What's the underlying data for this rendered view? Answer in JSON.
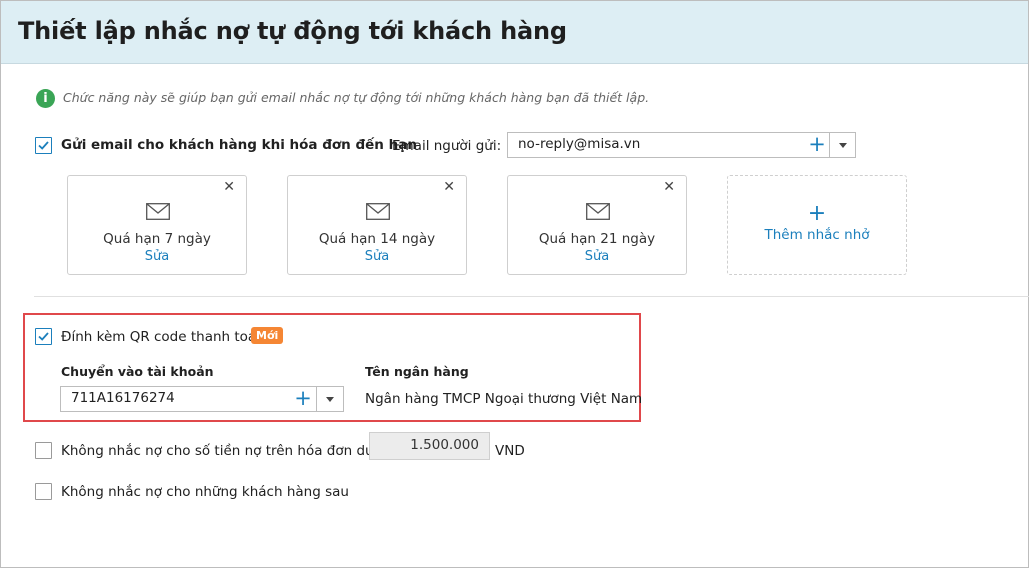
{
  "header": {
    "title": "Thiết lập nhắc nợ tự động tới khách hàng"
  },
  "info": {
    "icon": "info-icon",
    "text": "Chức năng này sẽ giúp bạn gửi email nhắc nợ tự động tới những khách hàng bạn đã thiết lập."
  },
  "email_option": {
    "checked": true,
    "label": "Gửi email cho khách hàng khi hóa đơn đến hạn",
    "sender_label": "Email người gửi:",
    "sender_value": "no-reply@misa.vn"
  },
  "reminders": [
    {
      "title": "Quá hạn 7 ngày",
      "edit": "Sửa"
    },
    {
      "title": "Quá hạn 14 ngày",
      "edit": "Sửa"
    },
    {
      "title": "Quá hạn 21 ngày",
      "edit": "Sửa"
    }
  ],
  "add_reminder": {
    "plus": "+",
    "label": "Thêm nhắc nhở"
  },
  "qr": {
    "checked": true,
    "label": "Đính kèm QR code thanh toán",
    "badge": "Mới",
    "account_label": "Chuyển vào tài khoản",
    "account_value": "711A16176274",
    "bank_label": "Tên ngân hàng",
    "bank_value": "Ngân hàng TMCP Ngoại thương Việt Nam"
  },
  "min_amount": {
    "checked": false,
    "label": "Không nhắc nợ cho số tiền nợ trên hóa đơn dưới",
    "value": "1.500.000",
    "unit": "VND"
  },
  "exclude_customers": {
    "checked": false,
    "label": "Không nhắc nợ cho những khách hàng sau"
  },
  "colors": {
    "accent": "#1b7fbc",
    "header_bg": "#ddeef4",
    "badge": "#f58634",
    "highlight": "#e0484b",
    "info": "#3aa556"
  }
}
